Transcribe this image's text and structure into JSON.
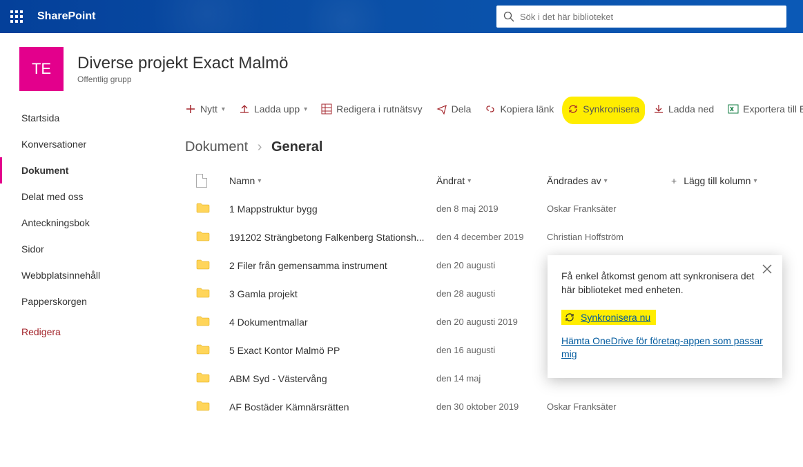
{
  "header": {
    "brand": "SharePoint",
    "search_placeholder": "Sök i det här biblioteket"
  },
  "site": {
    "initials": "TE",
    "title": "Diverse projekt Exact Malmö",
    "subtitle": "Offentlig grupp"
  },
  "nav": {
    "start": "Startsida",
    "conv": "Konversationer",
    "docs": "Dokument",
    "shared": "Delat med oss",
    "notebook": "Anteckningsbok",
    "pages": "Sidor",
    "contents": "Webbplatsinnehåll",
    "recycle": "Papperskorgen",
    "edit": "Redigera"
  },
  "toolbar": {
    "new": "Nytt",
    "upload": "Ladda upp",
    "grid": "Redigera i rutnätsvy",
    "share": "Dela",
    "copylink": "Kopiera länk",
    "sync": "Synkronisera",
    "download": "Ladda ned",
    "excel": "Exportera till Exc"
  },
  "crumb": {
    "root": "Dokument",
    "current": "General"
  },
  "columns": {
    "name": "Namn",
    "modified": "Ändrat",
    "by": "Ändrades av",
    "add": "Lägg till kolumn"
  },
  "rows": [
    {
      "name": "1 Mappstruktur bygg",
      "modified": "den 8 maj 2019",
      "by": "Oskar Franksäter"
    },
    {
      "name": "191202 Strängbetong Falkenberg Stationsh...",
      "modified": "den 4 december 2019",
      "by": "Christian Hoffström"
    },
    {
      "name": "2 Filer från gemensamma instrument",
      "modified": "den 20 augusti",
      "by": ""
    },
    {
      "name": "3 Gamla projekt",
      "modified": "den 28 augusti",
      "by": ""
    },
    {
      "name": "4 Dokumentmallar",
      "modified": "den 20 augusti 2019",
      "by": ""
    },
    {
      "name": "5 Exact Kontor Malmö PP",
      "modified": "den 16 augusti",
      "by": ""
    },
    {
      "name": "ABM Syd - Västervång",
      "modified": "den 14 maj",
      "by": ""
    },
    {
      "name": "AF Bostäder Kämnärsrätten",
      "modified": "den 30 oktober 2019",
      "by": "Oskar Franksäter"
    }
  ],
  "callout": {
    "text": "Få enkel åtkomst genom att synkronisera det här biblioteket med enheten.",
    "sync_now": "Synkronisera nu",
    "download": "Hämta OneDrive för företag-appen som passar mig"
  }
}
